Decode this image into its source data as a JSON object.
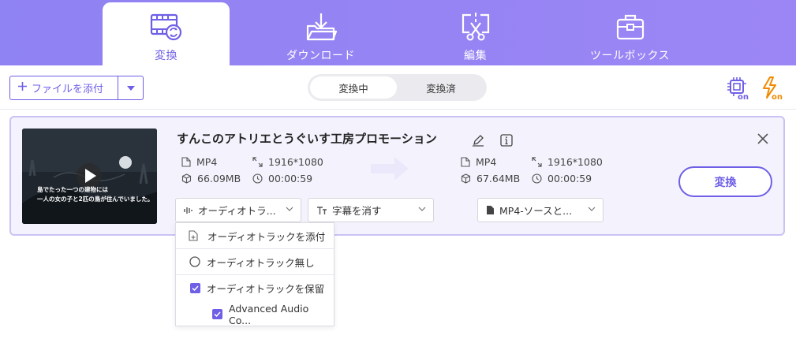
{
  "tabs": [
    {
      "label": "変換",
      "icon": "convert-film-icon",
      "active": true
    },
    {
      "label": "ダウンロード",
      "icon": "download-folder-icon",
      "active": false
    },
    {
      "label": "編集",
      "icon": "edit-scissors-icon",
      "active": false
    },
    {
      "label": "ツールボックス",
      "icon": "toolbox-icon",
      "active": false
    }
  ],
  "toolbar": {
    "add_file_label": "ファイルを添付",
    "segment": {
      "converting": "変換中",
      "converted": "変換済"
    },
    "right_icons": [
      "gpu-accel-on-icon",
      "high-speed-on-icon"
    ]
  },
  "file": {
    "title": "すんこのアトリエとうぐいす工房プロモーション",
    "source": {
      "format": "MP4",
      "resolution": "1916*1080",
      "size": "66.09MB",
      "duration": "00:00:59"
    },
    "target": {
      "format": "MP4",
      "resolution": "1916*1080",
      "size": "67.64MB",
      "duration": "00:00:59"
    },
    "thumbnail_caption_line1": "島でたった一つの建物には",
    "thumbnail_caption_line2": "一人の女の子と2匹の鳥が住んでいました。",
    "audio_dropdown": "オーディオトラ...",
    "subtitle_dropdown": "字幕を消す",
    "output_dropdown": "MP4-ソースと...",
    "convert_label": "変換"
  },
  "audio_menu": {
    "add_track": "オーディオトラックを添付",
    "no_track": "オーディオトラック無し",
    "keep_track": "オーディオトラックを保留",
    "track_name": "Advanced Audio Co..."
  },
  "colors": {
    "accent": "#6e5fe6",
    "topbar": "#9484f3",
    "card_bg": "#f4f3fd",
    "card_border": "#c9c3f5",
    "gpu_orange": "#f08a00"
  }
}
